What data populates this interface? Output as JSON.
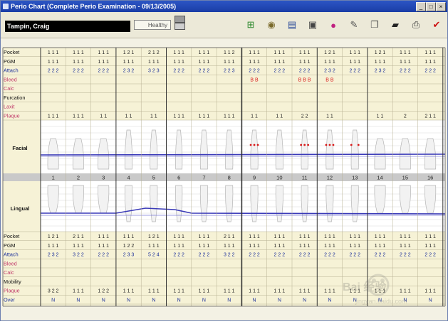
{
  "window": {
    "title": "Perio Chart (Complete Perio Examination - 09/13/2005)",
    "minimize_label": "_",
    "maximize_label": "□",
    "close_label": "×"
  },
  "patient": {
    "name": "Tampin, Craig"
  },
  "status_field": {
    "value": "Healthy"
  },
  "toolbar": {
    "buttons": [
      {
        "name": "add-exam-button",
        "icon": "plus-grid-icon",
        "glyph": "⊞",
        "color": "#2f8a2f"
      },
      {
        "name": "tooth-chart-button",
        "icon": "tooth-icon",
        "glyph": "◉",
        "color": "#7a6a2a"
      },
      {
        "name": "notes-button",
        "icon": "document-icon",
        "glyph": "▤",
        "color": "#2d4d9a"
      },
      {
        "name": "view-button",
        "icon": "window-icon",
        "glyph": "▣",
        "color": "#444"
      },
      {
        "name": "color-button",
        "icon": "palette-icon",
        "glyph": "●",
        "color": "#c02080"
      },
      {
        "name": "probe-button",
        "icon": "probe-icon",
        "glyph": "✎",
        "color": "#555"
      },
      {
        "name": "report-button",
        "icon": "report-icon",
        "glyph": "❐",
        "color": "#555"
      },
      {
        "name": "open-button",
        "icon": "folder-icon",
        "glyph": "▰",
        "color": "#222"
      },
      {
        "name": "print-button",
        "icon": "printer-icon",
        "glyph": "⎙",
        "color": "#333"
      },
      {
        "name": "close-chart-button",
        "icon": "check-icon",
        "glyph": "✔",
        "color": "#cc1010"
      }
    ]
  },
  "colors": {
    "grid_bg": "#f6f2d6",
    "tooth_bg": "#ffffff",
    "gum_line": "#3a3ab8",
    "bleed": "#d81818",
    "row_label_black": "#111111",
    "row_label_pink": "#c03a6a",
    "row_label_blue": "#1b2f9a"
  },
  "labels": {
    "facial": "Facial",
    "lingual": "Lingual"
  },
  "upper_rows": [
    {
      "label": "Pocket",
      "color": "black",
      "values": [
        "1 1 1",
        "1 1 1",
        "1 1 1",
        "1 2 1",
        "2 1 2",
        "1 1 1",
        "1 1 1",
        "1 1 2",
        "1 1 1",
        "1 1 1",
        "1 1 1",
        "1 2 1",
        "1 1 1",
        "1 2 1",
        "1 1 1",
        "1 1 1"
      ]
    },
    {
      "label": "PGM",
      "color": "black",
      "values": [
        "1 1 1",
        "1 1 1",
        "1 1 1",
        "1 1 1",
        "1 1 1",
        "1 1 1",
        "1 1 1",
        "1 1 1",
        "1 1 1",
        "1 1 1",
        "1 1 1",
        "1 1 1",
        "1 1 1",
        "1 1 1",
        "1 1 1",
        "1 1 1"
      ]
    },
    {
      "label": "Attach",
      "color": "blue",
      "values": [
        "2 2 2",
        "2 2 2",
        "2 2 2",
        "2 3 2",
        "3 2 3",
        "2 2 2",
        "2 2 2",
        "2 2 3",
        "2 2 2",
        "2 2 2",
        "2 2 2",
        "2 3 2",
        "2 2 2",
        "2 3 2",
        "2 2 2",
        "2 2 2"
      ]
    },
    {
      "label": "Bleed",
      "color": "pink",
      "values": [
        "",
        "",
        "",
        "",
        "",
        "",
        "",
        "",
        "B B",
        "",
        "B B B",
        "B B",
        "",
        "",
        "",
        ""
      ]
    },
    {
      "label": "Calc",
      "color": "pink",
      "values": [
        "",
        "",
        "",
        "",
        "",
        "",
        "",
        "",
        "",
        "",
        "",
        "",
        "",
        "",
        "",
        ""
      ]
    },
    {
      "label": "Furcation",
      "color": "black",
      "values": [
        "",
        "",
        "",
        "",
        "",
        "",
        "",
        "",
        "",
        "",
        "",
        "",
        "",
        "",
        "",
        ""
      ]
    },
    {
      "label": "Laxit",
      "color": "pink",
      "values": [
        "",
        "",
        "",
        "",
        "",
        "",
        "",
        "",
        "",
        "",
        "",
        "",
        "",
        "",
        "",
        ""
      ]
    },
    {
      "label": "Plaque",
      "color": "pink",
      "values": [
        "1 1 1",
        "1 1 1",
        "1 1",
        "1 1",
        "1 1",
        "1 1 1",
        "1 1 1",
        "1 1 1",
        "1 1",
        "1 1",
        "2 2",
        "1 1",
        "",
        "1 1",
        "2",
        "2 1 1"
      ]
    }
  ],
  "tooth_numbers": [
    "1",
    "2",
    "3",
    "4",
    "5",
    "6",
    "7",
    "8",
    "9",
    "10",
    "11",
    "12",
    "13",
    "14",
    "15",
    "16"
  ],
  "lower_rows": [
    {
      "label": "Pocket",
      "color": "black",
      "values": [
        "1 2 1",
        "2 1 1",
        "1 1 1",
        "1 1 1",
        "1 2 1",
        "1 1 1",
        "1 1 1",
        "2 1 1",
        "1 1 1",
        "1 1 1",
        "1 1 1",
        "1 1 1",
        "1 1 1",
        "1 1 1",
        "1 1 1",
        "1 1 1"
      ]
    },
    {
      "label": "PGM",
      "color": "black",
      "values": [
        "1 1 1",
        "1 1 1",
        "1 1 1",
        "1 2 2",
        "1 1 1",
        "1 1 1",
        "1 1 1",
        "1 1 1",
        "1 1 1",
        "1 1 1",
        "1 1 1",
        "1 1 1",
        "1 1 1",
        "1 1 1",
        "1 1 1",
        "1 1 1"
      ]
    },
    {
      "label": "Attach",
      "color": "blue",
      "values": [
        "2 3 2",
        "3 2 2",
        "2 2 2",
        "2 3 3",
        "5 2 4",
        "2 2 2",
        "2 2 2",
        "3 2 2",
        "2 2 2",
        "2 2 2",
        "2 2 2",
        "2 2 2",
        "2 2 2",
        "2 2 2",
        "2 2 2",
        "2 2 2"
      ]
    },
    {
      "label": "Bleed",
      "color": "pink",
      "values": [
        "",
        "",
        "",
        "",
        "",
        "",
        "",
        "",
        "",
        "",
        "",
        "",
        "",
        "",
        "",
        ""
      ]
    },
    {
      "label": "Calc",
      "color": "pink",
      "values": [
        "",
        "",
        "",
        "",
        "",
        "",
        "",
        "",
        "",
        "",
        "",
        "",
        "",
        "",
        "",
        ""
      ]
    },
    {
      "label": "Mobility",
      "color": "black",
      "values": [
        "",
        "",
        "",
        "",
        "",
        "",
        "",
        "",
        "",
        "",
        "",
        "",
        "",
        "",
        "",
        ""
      ]
    },
    {
      "label": "Plaque",
      "color": "pink",
      "values": [
        "3 2 2",
        "1 1 1",
        "1 2 2",
        "1 1 1",
        "1 1 1",
        "1 1 1",
        "1 1 1",
        "1 1 1",
        "1 1 1",
        "1 1 1",
        "1 1 1",
        "1 1 1",
        "1 1 1",
        "1 1 1",
        "1 1 1",
        "1 1 1"
      ]
    },
    {
      "label": "Over",
      "color": "blue",
      "values": [
        "N",
        "N",
        "N",
        "N",
        "N",
        "N",
        "N",
        "N",
        "N",
        "N",
        "N",
        "N",
        "N",
        "N",
        "N",
        "N"
      ]
    }
  ],
  "bleed_markers": {
    "facial": [
      8,
      10,
      11,
      12
    ]
  },
  "watermark": {
    "text": "Bai 经验",
    "sub": "jingyan.baidu.com"
  }
}
